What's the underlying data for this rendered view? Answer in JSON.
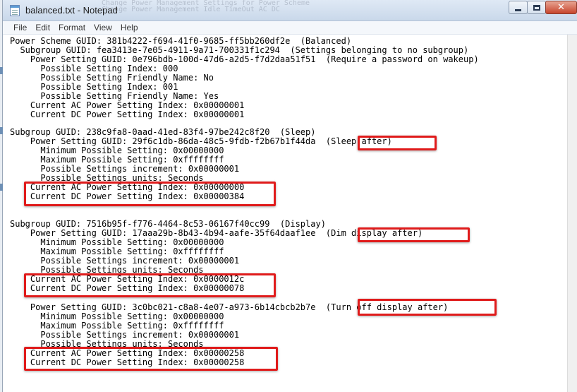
{
  "window": {
    "title": "balanced.txt - Notepad",
    "background_text": [
      "Change Power Management Settings for Power Scheme",
      "  Change Power Management Idle TimeOut   AC   DC"
    ]
  },
  "menu": [
    "File",
    "Edit",
    "Format",
    "View",
    "Help"
  ],
  "lines": [
    "Power Scheme GUID: 381b4222-f694-41f0-9685-ff5bb260df2e  (Balanced)",
    "  Subgroup GUID: fea3413e-7e05-4911-9a71-700331f1c294  (Settings belonging to no subgroup)",
    "    Power Setting GUID: 0e796bdb-100d-47d6-a2d5-f7d2daa51f51  (Require a password on wakeup)",
    "      Possible Setting Index: 000",
    "      Possible Setting Friendly Name: No",
    "      Possible Setting Index: 001",
    "      Possible Setting Friendly Name: Yes",
    "    Current AC Power Setting Index: 0x00000001",
    "    Current DC Power Setting Index: 0x00000001",
    "",
    "Subgroup GUID: 238c9fa8-0aad-41ed-83f4-97be242c8f20  (Sleep)",
    "    Power Setting GUID: 29f6c1db-86da-48c5-9fdb-f2b67b1f44da  (Sleep after)",
    "      Minimum Possible Setting: 0x00000000",
    "      Maximum Possible Setting: 0xffffffff",
    "      Possible Settings increment: 0x00000001",
    "      Possible Settings units: Seconds",
    "    Current AC Power Setting Index: 0x00000000",
    "    Current DC Power Setting Index: 0x00000384",
    "",
    "",
    "Subgroup GUID: 7516b95f-f776-4464-8c53-06167f40cc99  (Display)",
    "    Power Setting GUID: 17aaa29b-8b43-4b94-aafe-35f64daaf1ee  (Dim display after)",
    "      Minimum Possible Setting: 0x00000000",
    "      Maximum Possible Setting: 0xffffffff",
    "      Possible Settings increment: 0x00000001",
    "      Possible Settings units: Seconds",
    "    Current AC Power Setting Index: 0x0000012c",
    "    Current DC Power Setting Index: 0x00000078",
    "",
    "    Power Setting GUID: 3c0bc021-c8a8-4e07-a973-6b14cbcb2b7e  (Turn off display after)",
    "      Minimum Possible Setting: 0x00000000",
    "      Maximum Possible Setting: 0xffffffff",
    "      Possible Settings increment: 0x00000001",
    "      Possible Settings units: Seconds",
    "    Current AC Power Setting Index: 0x00000258",
    "    Current DC Power Setting Index: 0x00000258"
  ],
  "colors": {
    "highlight": "#e01b1b",
    "titlebar": "#c9d8ea"
  },
  "icons": [
    "notepad-icon",
    "minimize-icon",
    "maximize-icon",
    "close-icon"
  ]
}
